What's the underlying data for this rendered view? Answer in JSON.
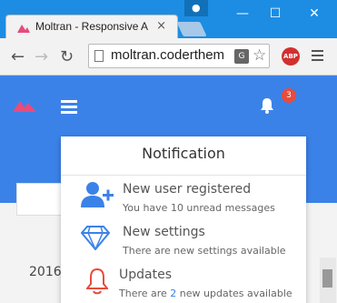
{
  "browser": {
    "tab_title": "Moltran - Responsive A",
    "tab_close": "×",
    "url": "moltran.coderthem",
    "translate_label": "G",
    "abp_label": "ABP"
  },
  "app": {
    "notification_count": "3"
  },
  "dropdown": {
    "title": "Notification",
    "items": [
      {
        "title": "New user registered",
        "subtitle": "You have 10 unread messages"
      },
      {
        "title": "New settings",
        "subtitle": "There are new settings available"
      },
      {
        "title": "Updates",
        "subtitle_prefix": "There are ",
        "subtitle_num": "2",
        "subtitle_suffix": " new updates available"
      }
    ]
  },
  "page": {
    "year_text": "2016 ("
  },
  "colors": {
    "accent": "#3b82e8",
    "badge": "#e74c3c",
    "bell_red": "#e74c3c"
  }
}
